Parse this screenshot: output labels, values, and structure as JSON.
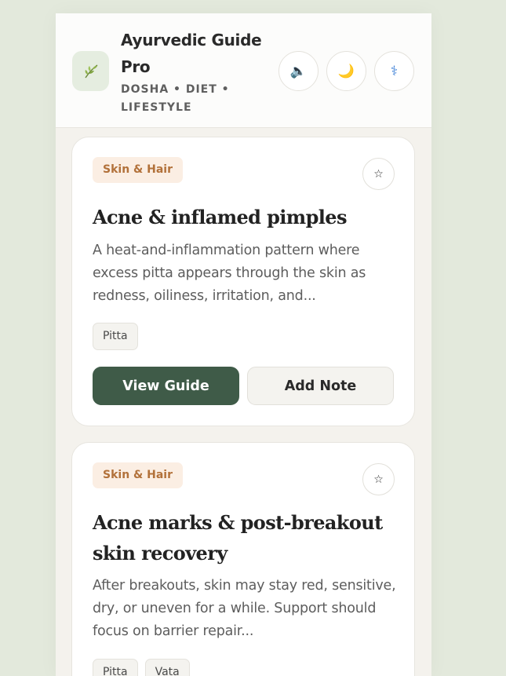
{
  "header": {
    "title": "Ayurvedic Guide Pro",
    "subtitle": "DOSHA • DIET • LIFESTYLE",
    "logo_icon": "leaf-icon",
    "buttons": {
      "sound": "🔈",
      "theme": "🌙",
      "medical": "⚕"
    }
  },
  "cards": [
    {
      "badge": "Skin & Hair",
      "star": "☆",
      "title": "Acne & inflamed pimples",
      "description": "A heat-and-inflammation pattern where excess pitta appears through the skin as redness, oiliness, irritation, and...",
      "tags": [
        "Pitta"
      ],
      "primary_button": "View Guide",
      "secondary_button": "Add Note"
    },
    {
      "badge": "Skin & Hair",
      "star": "☆",
      "title": "Acne marks & post-breakout skin recovery",
      "description": "After breakouts, skin may stay red, sensitive, dry, or uneven for a while. Support should focus on barrier repair...",
      "tags": [
        "Pitta",
        "Vata"
      ]
    }
  ],
  "colors": {
    "page_bg": "#e3e9dc",
    "accent": "#3f5b48",
    "badge_bg": "#fbeee3",
    "badge_text": "#b2713a"
  }
}
